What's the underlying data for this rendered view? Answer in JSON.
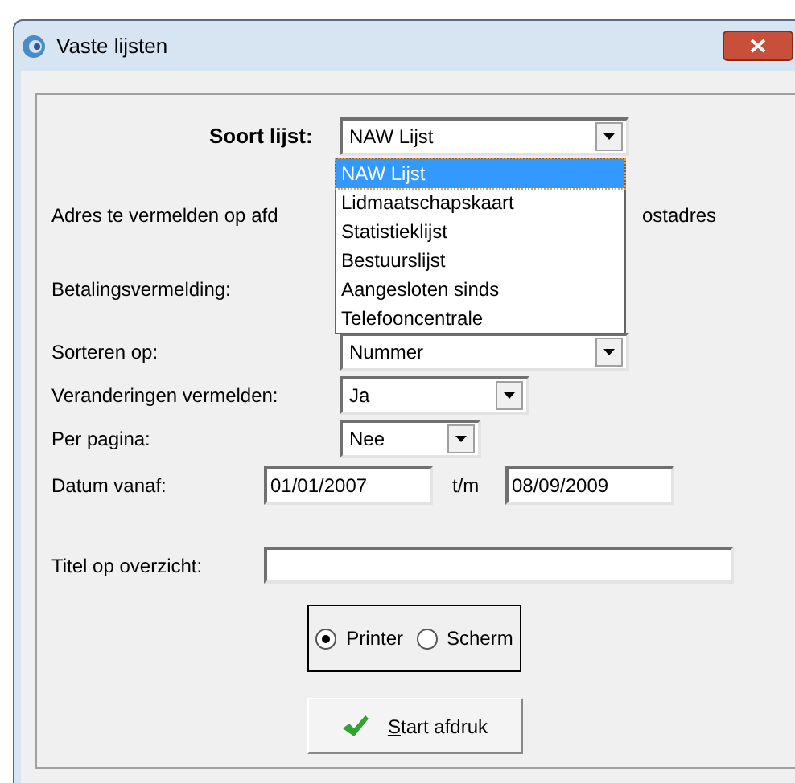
{
  "window": {
    "title": "Vaste lijsten"
  },
  "list_type": {
    "label": "Soort lijst:",
    "value": "NAW Lijst",
    "options": [
      {
        "label": "NAW Lijst",
        "selected": true
      },
      {
        "label": "Lidmaatschapskaart",
        "selected": false
      },
      {
        "label": "Statistieklijst",
        "selected": false
      },
      {
        "label": "Bestuurslijst",
        "selected": false
      },
      {
        "label": "Aangesloten sinds",
        "selected": false
      },
      {
        "label": "Telefooncentrale",
        "selected": false
      }
    ]
  },
  "address": {
    "label": "Adres te vermelden op afd",
    "trailing": "ostadres"
  },
  "payment": {
    "label": "Betalingsvermelding:"
  },
  "combos": [
    {
      "label": "Sorteren op:",
      "value": "Nummer"
    },
    {
      "label": "Veranderingen vermelden:",
      "value": "Ja"
    },
    {
      "label": "Per pagina:",
      "value": "Nee"
    }
  ],
  "date": {
    "label": "Datum vanaf:",
    "from": "01/01/2007",
    "separator": "t/m",
    "to": "08/09/2009"
  },
  "title_field": {
    "label": "Titel op overzicht:"
  },
  "output": [
    {
      "label": "Printer",
      "selected": true
    },
    {
      "label": "Scherm",
      "selected": false
    }
  ],
  "start_button": {
    "label": "Start afdruk"
  }
}
